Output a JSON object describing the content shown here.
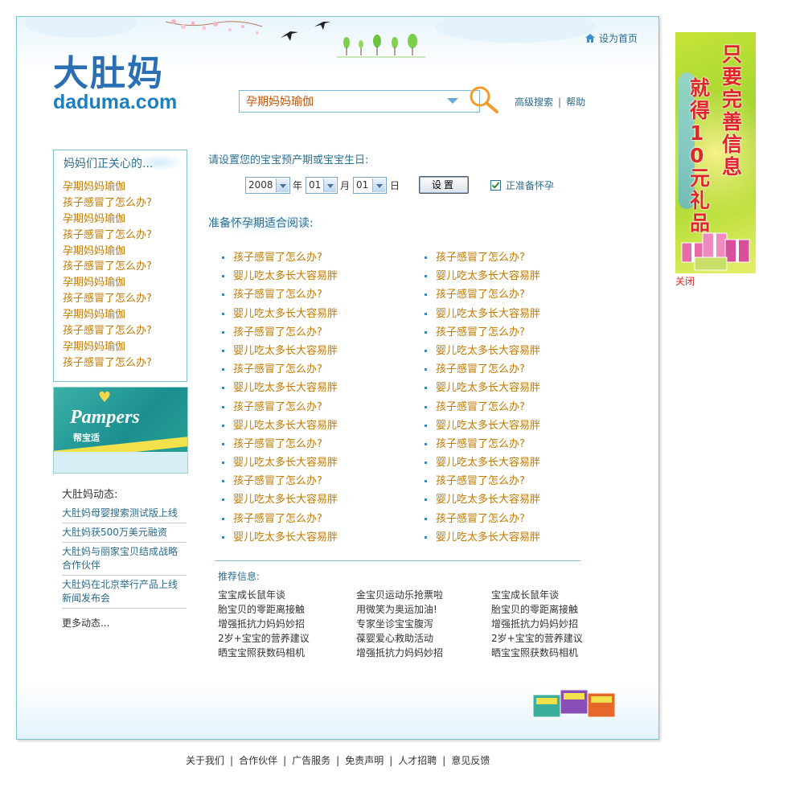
{
  "header": {
    "logo_cn": "大肚妈",
    "logo_en": "daduma.com",
    "set_home": "设为首页",
    "search_value": "孕期妈妈瑜伽",
    "advanced_search": "高级搜索",
    "separator": "|",
    "help": "帮助"
  },
  "sidebar": {
    "concern_title": "妈妈们正关心的...",
    "concern_items": [
      "孕期妈妈瑜伽",
      "孩子感冒了怎么办?",
      "孕期妈妈瑜伽",
      "孩子感冒了怎么办?",
      "孕期妈妈瑜伽",
      "孩子感冒了怎么办?",
      "孕期妈妈瑜伽",
      "孩子感冒了怎么办?",
      "孕期妈妈瑜伽",
      "孩子感冒了怎么办?",
      "孕期妈妈瑜伽",
      "孩子感冒了怎么办?"
    ],
    "ad_brand": "Pampers",
    "ad_brand_cn": "帮宝适",
    "news_title": "大肚妈动态:",
    "news_items": [
      "大肚妈母婴搜索测试版上线",
      "大肚妈获500万美元融资",
      "大肚妈与丽家宝贝结成战略合作伙伴",
      "大肚妈在北京举行产品上线新闻发布会"
    ],
    "news_more": "更多动态..."
  },
  "main": {
    "duedate_label": "请设置您的宝宝预产期或宝宝生日:",
    "year_value": "2008",
    "year_unit": "年",
    "month_value": "01",
    "month_unit": "月",
    "day_value": "01",
    "day_unit": "日",
    "set_button": "设置",
    "preparing_label": "正准备怀孕",
    "preparing_checked": true,
    "reading_title": "准备怀孕期适合阅读:",
    "articles_left": [
      "孩子感冒了怎么办?",
      "婴儿吃太多长大容易胖",
      "孩子感冒了怎么办?",
      "婴儿吃太多长大容易胖",
      "孩子感冒了怎么办?",
      "婴儿吃太多长大容易胖",
      "孩子感冒了怎么办?",
      "婴儿吃太多长大容易胖",
      "孩子感冒了怎么办?",
      "婴儿吃太多长大容易胖",
      "孩子感冒了怎么办?",
      "婴儿吃太多长大容易胖",
      "孩子感冒了怎么办?",
      "婴儿吃太多长大容易胖",
      "孩子感冒了怎么办?",
      "婴儿吃太多长大容易胖"
    ],
    "articles_right": [
      "孩子感冒了怎么办?",
      "婴儿吃太多长大容易胖",
      "孩子感冒了怎么办?",
      "婴儿吃太多长大容易胖",
      "孩子感冒了怎么办?",
      "婴儿吃太多长大容易胖",
      "孩子感冒了怎么办?",
      "婴儿吃太多长大容易胖",
      "孩子感冒了怎么办?",
      "婴儿吃太多长大容易胖",
      "孩子感冒了怎么办?",
      "婴儿吃太多长大容易胖",
      "孩子感冒了怎么办?",
      "婴儿吃太多长大容易胖",
      "孩子感冒了怎么办?",
      "婴儿吃太多长大容易胖"
    ],
    "recommend_title": "推荐信息:",
    "recommend_col1": [
      "宝宝成长鼠年谈",
      "胎宝贝的零距离接触",
      "增强抵抗力妈妈妙招",
      "2岁+宝宝的营养建议",
      "晒宝宝照获数码相机"
    ],
    "recommend_col2": [
      "金宝贝运动乐抢票啦",
      "用微笑为奥运加油!",
      "专家坐诊宝宝腹泻",
      "葆婴爱心救助活动",
      "增强抵抗力妈妈妙招"
    ],
    "recommend_col3": [
      "宝宝成长鼠年谈",
      "胎宝贝的零距离接触",
      "增强抵抗力妈妈妙招",
      "2岁+宝宝的营养建议",
      "晒宝宝照获数码相机"
    ]
  },
  "banner": {
    "text_line1": "只要完善信息",
    "text_line2": "就得10元礼品",
    "close": "关闭"
  },
  "footer": {
    "links": [
      "关于我们",
      "合作伙伴",
      "广告服务",
      "免责声明",
      "人才招聘",
      "意见反馈"
    ],
    "separator": "|"
  },
  "colors": {
    "accent_blue": "#2b6f95",
    "link_orange": "#c17a00",
    "border_teal": "#7fc3d2",
    "banner_red": "#e0262a"
  },
  "icons": [
    "home-icon",
    "search-magnifier-icon",
    "dropdown-arrow-icon",
    "checkbox-icon",
    "bird-icon",
    "tree-icon",
    "gift-icon"
  ]
}
